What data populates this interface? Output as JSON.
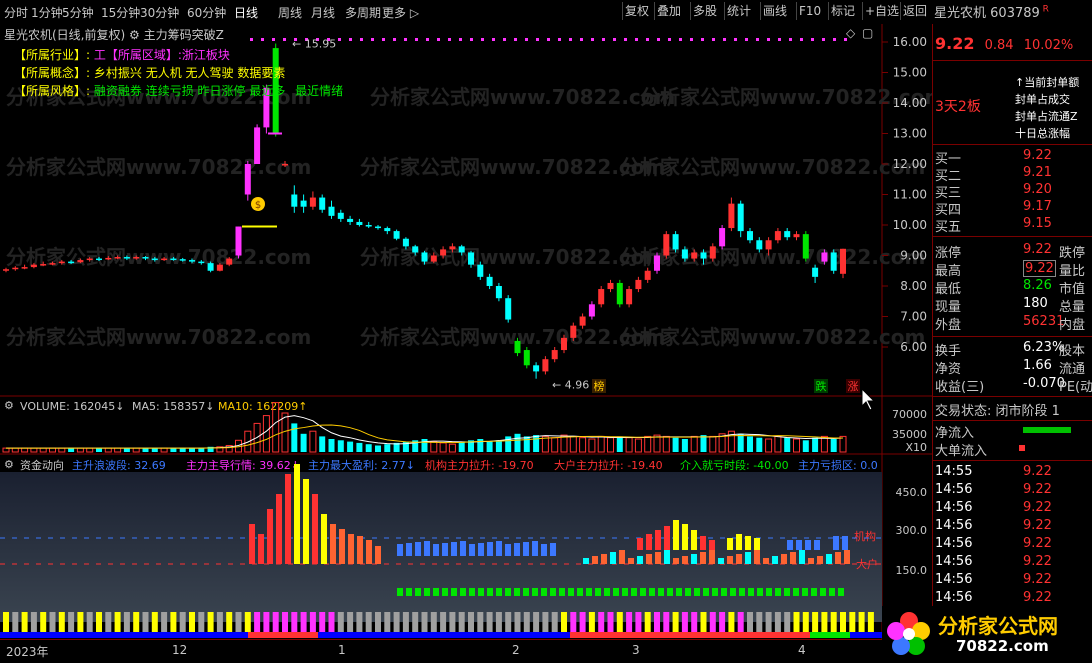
{
  "toolbar": {
    "periods": [
      "分时",
      "1分钟",
      "5分钟",
      "15分钟",
      "30分钟",
      "60分钟",
      "日线",
      "周线",
      "月线",
      "多周期",
      "更多 ▷"
    ],
    "active_period": "日线",
    "right_buttons": [
      "复权",
      "叠加",
      "多股",
      "统计",
      "画线",
      "F10",
      "标记",
      "+自选",
      "返回"
    ]
  },
  "chart_header": {
    "title": "星光农机(日线,前复权)",
    "indicator": "主力筹码突破Z"
  },
  "stock_info": {
    "industry_label": "【所属行业】",
    "industry_value": "工【所属区域】:浙江板块",
    "concept_label": "【所属概念】",
    "concept_value": "乡村振兴 无人机 无人驾驶 数据要素",
    "style_label": "【所属风格】",
    "style_value": "融资融券 连续亏损 昨日涨停 最近多",
    "style_value2": "最近情绪"
  },
  "price_axis": [
    "16.00",
    "15.00",
    "14.00",
    "13.00",
    "12.00",
    "11.00",
    "10.00",
    "9.00",
    "8.00",
    "7.00",
    "6.00"
  ],
  "annotations": {
    "high": "15.95",
    "low": "4.96",
    "bang": "榜",
    "die": "跌",
    "zhang": "涨",
    "bag": "$"
  },
  "volume_header": {
    "volume_label": "VOLUME: 162045",
    "ma5_label": "MA5: 158357",
    "ma10_label": "MA10: 162209"
  },
  "volume_axis": [
    "70000",
    "35000",
    "X10"
  ],
  "fund_header": {
    "title": "资金动向",
    "items": [
      {
        "text": "主升浪波段: 32.69",
        "color": "#3c78ff"
      },
      {
        "text": "主力主导行情: 39.62",
        "color": "#ff32ff"
      },
      {
        "text": "主力最大盈利: 2.77",
        "color": "#3c78ff"
      },
      {
        "text": "机构主力拉升: -19.70",
        "color": "#ff3232"
      },
      {
        "text": "大户主力拉升: -19.40",
        "color": "#ff3232"
      },
      {
        "text": "介入就亏时段: -40.00",
        "color": "#00e600"
      },
      {
        "text": "主力亏损区: 0.0",
        "color": "#3c78ff"
      }
    ]
  },
  "fund_axis": [
    "450.0",
    "300.0",
    "150.0"
  ],
  "fund_labels": {
    "jigou": "机构",
    "dahu": "大户"
  },
  "time_axis": [
    "2023年",
    "12",
    "1",
    "2",
    "3",
    "4"
  ],
  "right_panel": {
    "name": "星光农机",
    "code": "603789",
    "r_mark": "R",
    "price": "9.22",
    "change": "0.84",
    "pct": "10.02%",
    "board": "3天2板",
    "notes": [
      "当前封单额",
      "封单占成交",
      "封单占流通Z",
      "十日总涨幅"
    ],
    "asks": [
      {
        "label": "买一",
        "value": "9.22"
      },
      {
        "label": "买二",
        "value": "9.21"
      },
      {
        "label": "买三",
        "value": "9.20"
      },
      {
        "label": "买四",
        "value": "9.17"
      },
      {
        "label": "买五",
        "value": "9.15"
      }
    ],
    "stats": [
      {
        "label": "涨停",
        "value": "9.22",
        "color": "#ff3232",
        "extra": "跌停"
      },
      {
        "label": "最高",
        "value": "9.22",
        "color": "#ff3232",
        "extra": "量比"
      },
      {
        "label": "最低",
        "value": "8.26",
        "color": "#00e600",
        "extra": "市值"
      },
      {
        "label": "现量",
        "value": "180",
        "color": "#ffffff",
        "extra": "总量"
      },
      {
        "label": "外盘",
        "value": "56231",
        "color": "#ff3232",
        "extra": "内盘"
      }
    ],
    "stats2": [
      {
        "label": "换手",
        "value": "6.23%",
        "color": "#ffffff",
        "extra": "股本"
      },
      {
        "label": "净资",
        "value": "1.66",
        "color": "#ffffff",
        "extra": "流通"
      },
      {
        "label": "收益(三)",
        "value": "-0.070",
        "color": "#ffffff",
        "extra": "PE(动"
      }
    ],
    "trade_state": "交易状态: 闭市阶段 1",
    "net_in": "净流入",
    "big_in": "大单流入",
    "ticks": [
      {
        "time": "14:55",
        "price": "9.22"
      },
      {
        "time": "14:56",
        "price": "9.22"
      },
      {
        "time": "14:56",
        "price": "9.22"
      },
      {
        "time": "14:56",
        "price": "9.22"
      },
      {
        "time": "14:56",
        "price": "9.22"
      },
      {
        "time": "14:56",
        "price": "9.22"
      },
      {
        "time": "14:56",
        "price": "9.22"
      },
      {
        "time": "14:56",
        "price": "9.22"
      },
      {
        "time": "14:56",
        "price": "9.22"
      }
    ]
  },
  "logo": {
    "text": "分析家公式网",
    "url": "70822.com"
  },
  "watermark": "分析家公式网www.70822.com",
  "colors": {
    "up": "#ff3232",
    "down": "#00ffff",
    "bg": "#000000",
    "frame": "#7a0000"
  }
}
